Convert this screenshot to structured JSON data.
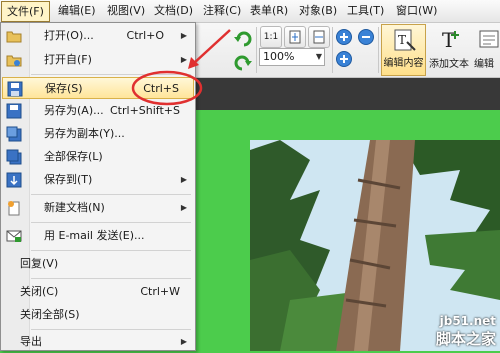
{
  "menubar": {
    "items": [
      "文件(F)",
      "编辑(E)",
      "视图(V)",
      "文档(D)",
      "注释(C)",
      "表单(R)",
      "对象(B)",
      "工具(T)",
      "窗口(W)"
    ]
  },
  "toolbar": {
    "zoom_value": "100%",
    "ratio_label": "1:1",
    "edit_content_label": "编辑内容",
    "add_text_label": "添加文本",
    "edit_label": "编辑"
  },
  "file_menu": {
    "open": {
      "label": "打开(O)...",
      "shortcut": "Ctrl+O"
    },
    "open_from": {
      "label": "打开自(F)"
    },
    "save": {
      "label": "保存(S)",
      "shortcut": "Ctrl+S"
    },
    "save_as": {
      "label": "另存为(A)...",
      "shortcut": "Ctrl+Shift+S"
    },
    "save_copy": {
      "label": "另存为副本(Y)..."
    },
    "save_all": {
      "label": "全部保存(L)"
    },
    "save_to": {
      "label": "保存到(T)"
    },
    "new_doc": {
      "label": "新建文档(N)"
    },
    "email": {
      "label": "用 E-mail 发送(E)..."
    },
    "revert": {
      "label": "回复(V)"
    },
    "close": {
      "label": "关闭(C)",
      "shortcut": "Ctrl+W"
    },
    "close_all": {
      "label": "关闭全部(S)"
    },
    "export": {
      "label": "导出"
    }
  },
  "watermark": {
    "url": "jb51.net",
    "name": "脚本之家"
  },
  "colors": {
    "background": "#4ccc4c",
    "menu_highlight": "#ffe59a",
    "annotation": "#e03030"
  }
}
